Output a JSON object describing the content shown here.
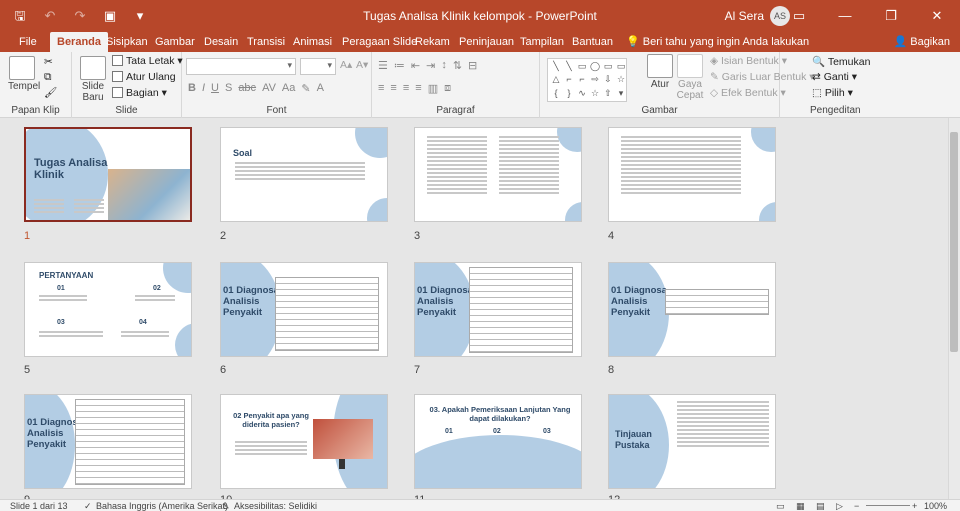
{
  "window": {
    "title": "Tugas Analisa Klinik kelompok  -  PowerPoint",
    "user_name": "Al Sera",
    "user_initials": "AS"
  },
  "tabs": [
    "File",
    "Beranda",
    "Sisipkan",
    "Gambar",
    "Desain",
    "Transisi",
    "Animasi",
    "Peragaan Slide",
    "Rekam",
    "Peninjauan",
    "Tampilan",
    "Bantuan"
  ],
  "active_tab": "Beranda",
  "tell_me": "Beri tahu yang ingin Anda lakukan",
  "share_label": "Bagikan",
  "ribbon": {
    "clipboard": {
      "paste": "Tempel",
      "group": "Papan Klip"
    },
    "slide": {
      "new_slide_1": "Slide",
      "new_slide_2": "Baru",
      "layout": "Tata Letak",
      "reset": "Atur Ulang",
      "section": "Bagian",
      "group": "Slide"
    },
    "font": {
      "group": "Font"
    },
    "paragraph": {
      "group": "Paragraf"
    },
    "drawing": {
      "arrange": "Atur",
      "quick_styles_1": "Gaya",
      "quick_styles_2": "Cepat",
      "shape_fill": "Isian Bentuk",
      "shape_outline": "Garis Luar Bentuk",
      "shape_effects": "Efek Bentuk",
      "group": "Gambar"
    },
    "editing": {
      "find": "Temukan",
      "replace": "Ganti",
      "select": "Pilih",
      "group": "Pengeditan"
    }
  },
  "slides": [
    {
      "number": "1",
      "title": "Tugas Analisa Klinik"
    },
    {
      "number": "2",
      "title": "Soal"
    },
    {
      "number": "3",
      "title": ""
    },
    {
      "number": "4",
      "title": ""
    },
    {
      "number": "5",
      "title": "PERTANYAAN"
    },
    {
      "number": "6",
      "title": "01 Diagnosa Analisis Penyakit"
    },
    {
      "number": "7",
      "title": "01 Diagnosa Analisis Penyakit"
    },
    {
      "number": "8",
      "title": "01 Diagnosa Analisis Penyakit"
    },
    {
      "number": "9",
      "title": "01 Diagnosa Analisis Penyakit"
    },
    {
      "number": "10",
      "title": "02 Penyakit apa yang diderita pasien?"
    },
    {
      "number": "11",
      "title": "03. Apakah Pemeriksaan Lanjutan Yang dapat dilakukan?"
    },
    {
      "number": "12",
      "title": "Tinjauan Pustaka"
    }
  ],
  "slide5": {
    "q1": "01",
    "q2": "02",
    "q3": "03",
    "q4": "04"
  },
  "slide11": {
    "n1": "01",
    "n2": "02",
    "n3": "03"
  },
  "status": {
    "slide_count": "Slide 1 dari 13",
    "language": "Bahasa Inggris (Amerika Serikat)",
    "accessibility": "Aksesibilitas: Selidiki",
    "zoom": "100%"
  }
}
